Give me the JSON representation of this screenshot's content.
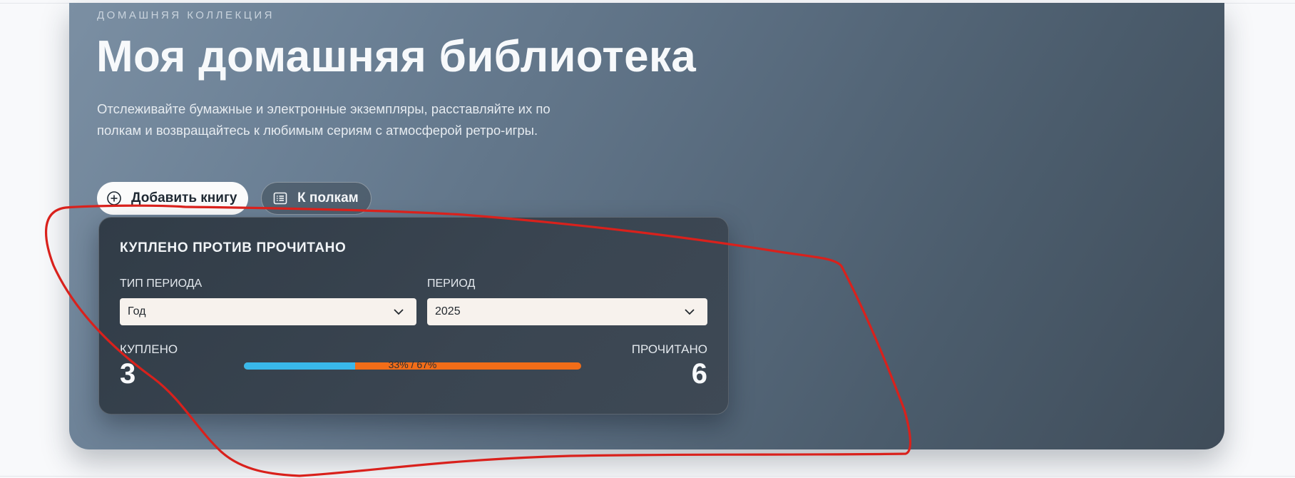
{
  "hero": {
    "eyebrow": "ДОМАШНЯЯ КОЛЛЕКЦИЯ",
    "title": "Моя домашняя библиотека",
    "description": "Отслеживайте бумажные и электронные экземпляры, расставляйте их по полкам и возвращайтесь к любимым сериям с атмосферой ретро-игры.",
    "buttons": {
      "add_book": "Добавить книгу",
      "to_shelves": "К полкам"
    }
  },
  "stats_card": {
    "title": "КУПЛЕНО ПРОТИВ ПРОЧИТАНО",
    "period_type": {
      "label": "ТИП ПЕРИОДА",
      "value": "Год"
    },
    "period": {
      "label": "ПЕРИОД",
      "value": "2025"
    },
    "bought": {
      "label": "КУПЛЕНО",
      "value": "3"
    },
    "read": {
      "label": "ПРОЧИТАНО",
      "value": "6"
    },
    "progress": {
      "bought_fraction": 0.33,
      "read_fraction": 0.67,
      "label": "33% / 67%"
    }
  },
  "colors": {
    "bought_bar": "#39b8ea",
    "read_bar": "#f26d18",
    "annotation": "#d9211c"
  },
  "icons": {
    "add_book": "plus-circle-icon",
    "to_shelves": "list-icon",
    "dropdown": "chevron-down-icon"
  }
}
